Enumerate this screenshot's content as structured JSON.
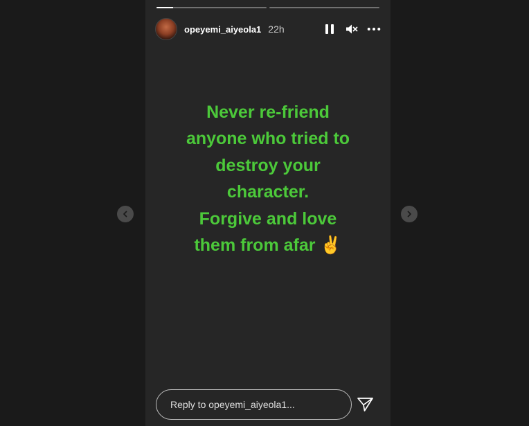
{
  "story": {
    "progress": [
      0.15,
      0
    ],
    "username": "opeyemi_aiyeola1",
    "time": "22h",
    "message_lines": [
      "Never re-friend",
      "anyone who tried to",
      "destroy your",
      "character.",
      "Forgive and love",
      "them from afar ✌️"
    ],
    "text_color": "#4cc93a"
  },
  "icons": {
    "pause": "pause-icon",
    "mute": "volume-muted-icon",
    "more": "more-options-icon",
    "prev": "chevron-left-icon",
    "next": "chevron-right-icon",
    "send": "send-icon"
  },
  "reply": {
    "placeholder": "Reply to opeyemi_aiyeola1..."
  }
}
